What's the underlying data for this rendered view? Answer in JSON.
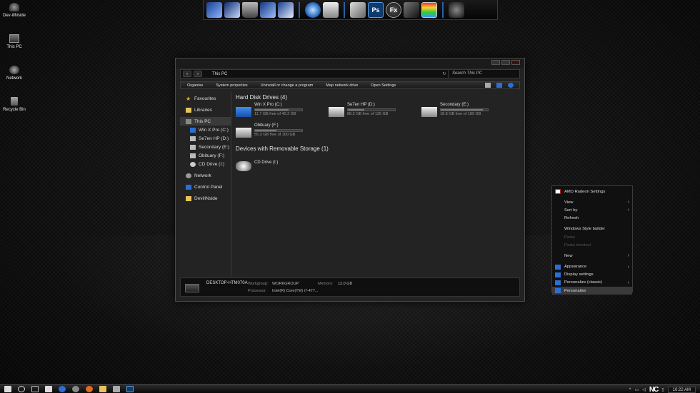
{
  "desktop": {
    "icons": [
      {
        "label": "Dev-illNside"
      },
      {
        "label": "This PC"
      },
      {
        "label": "Network"
      },
      {
        "label": "Recycle Bin"
      }
    ]
  },
  "dock": {
    "ps_label": "Ps",
    "fx_label": "Fx"
  },
  "explorer": {
    "address": "This PC",
    "search_placeholder": "Search This PC",
    "nav_back": "«",
    "nav_forward": "»",
    "toolbar": [
      "Organise",
      "System properties",
      "Uninstall or change a program",
      "Map network drive",
      "Open Settings"
    ],
    "nav": {
      "favourites": "Favourites",
      "libraries": "Libraries",
      "this_pc": "This PC",
      "drives": [
        "Win X Pro (C:)",
        "Se7en HP (D:)",
        "Secondary (E:)",
        "Obituary (F:)",
        "CD Drive (I:)"
      ],
      "network": "Network",
      "control_panel": "Control Panel",
      "devill": "DevillNside"
    },
    "hdd_header": "Hard Disk Drives (4)",
    "drives": [
      {
        "name": "Win X Pro (C:)",
        "free": "11.7 GB free of 40.2 GB",
        "used_fraction": 0.71
      },
      {
        "name": "Se7en HP (D:)",
        "free": "88.2 GB free of 135 GB",
        "used_fraction": 0.35
      },
      {
        "name": "Secondary (E:)",
        "free": "18.8 GB free of 189 GB",
        "used_fraction": 0.9
      },
      {
        "name": "Obituary (F:)",
        "free": "55.3 GB free of 100 GB",
        "used_fraction": 0.45
      }
    ],
    "removable_header": "Devices with Removable Storage (1)",
    "cd_drive": "CD Drive (I:)",
    "details": {
      "pc_name": "DESKTOP-HTM070A",
      "workgroup_label": "Workgroup:",
      "workgroup_value": "WORKGROUP",
      "memory_label": "Memory:",
      "memory_value": "12.0 GB",
      "processor_label": "Processor:",
      "processor_value": "Intel(R) Core(TM) i7-477..."
    }
  },
  "context_menu": {
    "items": [
      {
        "label": "AMD Radeon Settings"
      },
      {
        "label": "View"
      },
      {
        "label": "Sort by"
      },
      {
        "label": "Refresh"
      },
      {
        "label": "Windows Style builder"
      },
      {
        "label": "Paste"
      },
      {
        "label": "Paste shortcut"
      },
      {
        "label": "New"
      },
      {
        "label": "Appearance"
      },
      {
        "label": "Display settings"
      },
      {
        "label": "Personalize (classic)"
      },
      {
        "label": "Personalise"
      }
    ]
  },
  "taskbar": {
    "time": "10:22 AM",
    "brand": "NC"
  },
  "colors": {
    "accent_blue": "#2b6fd6",
    "amd_red": "#d42020",
    "favourites_star": "#f2b01e",
    "folder_yellow": "#e8c25a"
  }
}
